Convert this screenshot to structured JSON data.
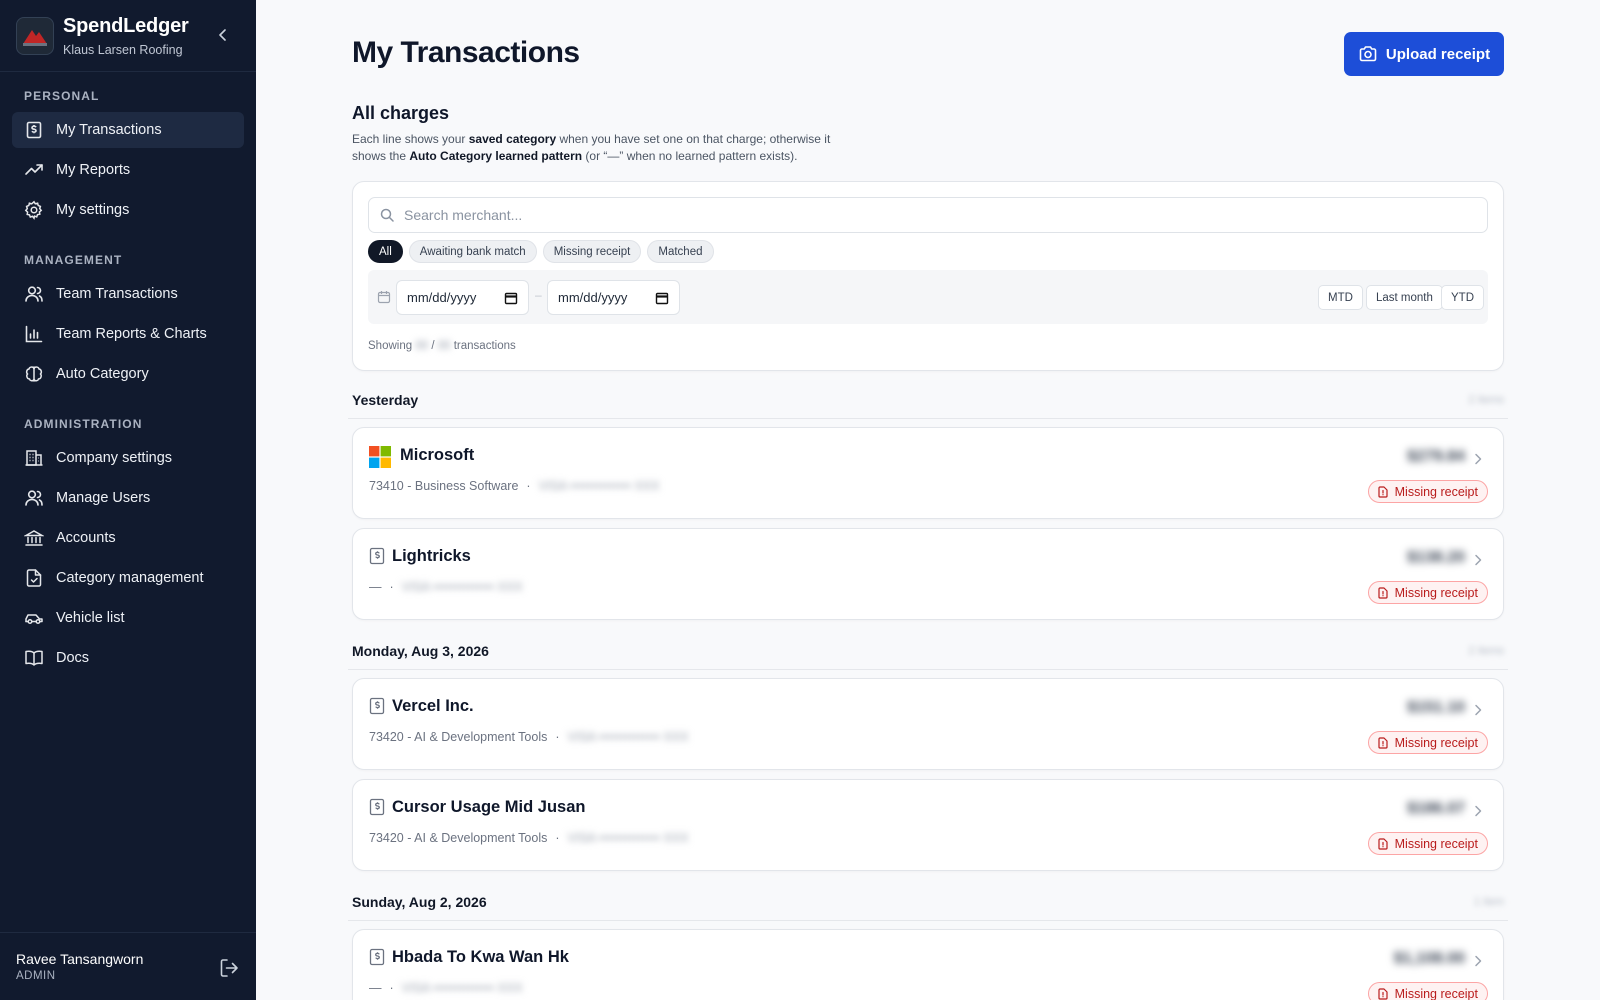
{
  "app": {
    "name": "SpendLedger",
    "company": "Klaus Larsen Roofing"
  },
  "sidebar": {
    "sections": [
      {
        "heading": "PERSONAL",
        "items": [
          {
            "label": "My Transactions",
            "icon": "receipt-dollar-icon",
            "active": true
          },
          {
            "label": "My Reports",
            "icon": "trending-up-icon"
          },
          {
            "label": "My settings",
            "icon": "gear-icon"
          }
        ]
      },
      {
        "heading": "MANAGEMENT",
        "items": [
          {
            "label": "Team Transactions",
            "icon": "users-icon"
          },
          {
            "label": "Team Reports & Charts",
            "icon": "bar-chart-icon"
          },
          {
            "label": "Auto Category",
            "icon": "brain-icon"
          }
        ]
      },
      {
        "heading": "ADMINISTRATION",
        "items": [
          {
            "label": "Company settings",
            "icon": "building-icon"
          },
          {
            "label": "Manage Users",
            "icon": "users-icon"
          },
          {
            "label": "Accounts",
            "icon": "bank-icon"
          },
          {
            "label": "Category management",
            "icon": "file-check-icon"
          },
          {
            "label": "Vehicle list",
            "icon": "car-icon"
          },
          {
            "label": "Docs",
            "icon": "book-icon"
          }
        ]
      }
    ],
    "user": {
      "name": "Ravee Tansangworn",
      "role": "ADMIN"
    }
  },
  "page": {
    "title": "My Transactions",
    "upload_label": "Upload receipt",
    "section_title": "All charges",
    "desc": {
      "p1": "Each line shows your ",
      "b1": "saved category",
      "p2": " when you have set one on that charge; otherwise it shows the ",
      "b2": "Auto Category learned pattern",
      "p3": " (or “—” when no learned pattern exists)."
    }
  },
  "filters": {
    "search_placeholder": "Search merchant...",
    "chips": [
      "All",
      "Awaiting bank match",
      "Missing receipt",
      "Matched"
    ],
    "active_chip": "All",
    "date_from": "mm/dd/yyyy",
    "date_to": "mm/dd/yyyy",
    "date_sep": "–",
    "ranges": [
      "MTD",
      "Last month",
      "YTD"
    ],
    "showing_prefix": "Showing",
    "showing_shown": "88",
    "showing_slash": "/",
    "showing_total": "88",
    "showing_suffix": "transactions"
  },
  "groups": [
    {
      "label": "Yesterday",
      "count": "2 items"
    },
    {
      "label": "Monday, Aug 3, 2026",
      "count": "2 items"
    },
    {
      "label": "Sunday, Aug 2, 2026",
      "count": "1 item"
    }
  ],
  "transactions": [
    {
      "merchant": "Microsoft",
      "icon": "microsoft-logo-icon",
      "category": "73410 - Business Software",
      "card": "VISA •••••••••••••• XXX",
      "amount": "$279.84",
      "status": "Missing receipt"
    },
    {
      "merchant": "Lightricks",
      "icon": "receipt-icon",
      "category": "—",
      "card": "VISA •••••••••••••• XXX",
      "amount": "$138.20",
      "status": "Missing receipt"
    },
    {
      "merchant": "Vercel Inc.",
      "icon": "receipt-icon",
      "category": "73420 - AI & Development Tools",
      "card": "VISA •••••••••••••• XXX",
      "amount": "$151.10",
      "status": "Missing receipt"
    },
    {
      "merchant": "Cursor Usage Mid Jusan",
      "icon": "receipt-icon",
      "category": "73420 - AI & Development Tools",
      "card": "VISA •••••••••••••• XXX",
      "amount": "$186.07",
      "status": "Missing receipt"
    },
    {
      "merchant": "Hbada To Kwa Wan Hk",
      "icon": "receipt-icon",
      "category": "—",
      "card": "VISA •••••••••••••• XXX",
      "amount": "$1,108.00",
      "status": "Missing receipt"
    }
  ],
  "colors": {
    "sidebar_bg": "#111a2e",
    "accent": "#1d4ed8",
    "danger": "#b91c1c"
  }
}
